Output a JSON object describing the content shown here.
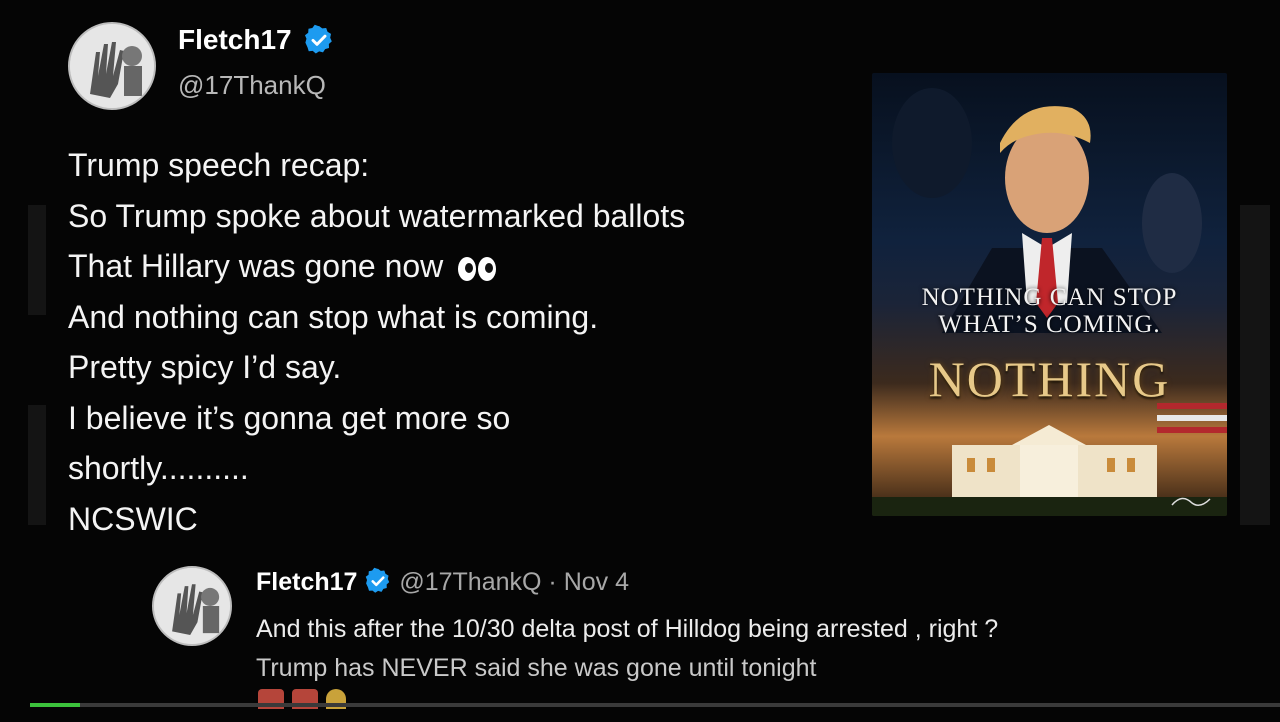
{
  "post": {
    "author_name": "Fletch17",
    "author_handle": "@17ThankQ",
    "lines": [
      "Trump speech recap:",
      "So Trump spoke about watermarked ballots",
      "That Hillary was gone now",
      "And nothing can stop what is coming.",
      "Pretty spicy I’d say.",
      "I believe it’s gonna get more so",
      "shortly..........",
      "NCSWIC"
    ],
    "line3_emoji": "eyes-emoji"
  },
  "poster": {
    "line1": "NOTHING CAN STOP",
    "line2": "WHAT’S COMING.",
    "big_word": "NOTHING"
  },
  "reply": {
    "author_name": "Fletch17",
    "author_handle": "@17ThankQ",
    "date": "· Nov 4",
    "line1": "And this after the 10/30 delta post of Hilldog being arrested , right ?",
    "line2": "Trump has NEVER said she was gone until tonight"
  },
  "video": {
    "progress_fraction": 0.04
  },
  "colors": {
    "verified": "#1d9bf0",
    "progress": "#3cc23c",
    "background": "#050505"
  }
}
